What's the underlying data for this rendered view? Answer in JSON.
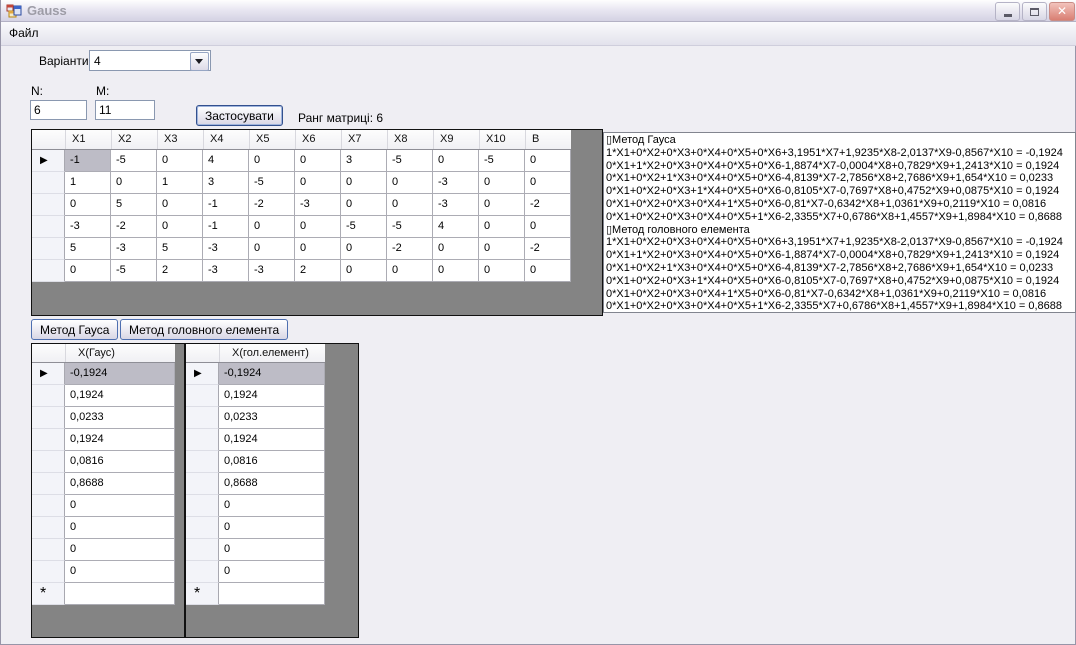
{
  "window": {
    "title": "Gauss"
  },
  "icons": {
    "close": "✕",
    "row_arrow": "▶",
    "new_row": "*"
  },
  "menu": {
    "items": [
      {
        "label": "Файл"
      }
    ]
  },
  "form": {
    "variants_label": "Варіанти:",
    "variants_value": "4",
    "n_label": "N:",
    "n_value": "6",
    "m_label": "M:",
    "m_value": "11",
    "apply_label": "Застосувати",
    "rank_label": "Ранг матриці: 6"
  },
  "matrix_grid": {
    "columns": [
      "X1",
      "X2",
      "X3",
      "X4",
      "X5",
      "X6",
      "X7",
      "X8",
      "X9",
      "X10",
      "B"
    ],
    "rows": [
      [
        -1,
        -5,
        0,
        4,
        0,
        0,
        3,
        -5,
        0,
        -5,
        0
      ],
      [
        1,
        0,
        1,
        3,
        -5,
        0,
        0,
        0,
        -3,
        0,
        0
      ],
      [
        0,
        5,
        0,
        -1,
        -2,
        -3,
        0,
        0,
        -3,
        0,
        -2
      ],
      [
        -3,
        -2,
        0,
        -1,
        0,
        0,
        -5,
        -5,
        4,
        0,
        0
      ],
      [
        5,
        -3,
        5,
        -3,
        0,
        0,
        0,
        -2,
        0,
        0,
        -2
      ],
      [
        0,
        -5,
        2,
        -3,
        -3,
        2,
        0,
        0,
        0,
        0,
        0
      ]
    ],
    "selected": {
      "row": 0,
      "col": 0
    }
  },
  "output_panel": {
    "lines": [
      "▯Метод Гауса",
      "1*X1+0*X2+0*X3+0*X4+0*X5+0*X6+3,1951*X7+1,9235*X8-2,0137*X9-0,8567*X10 = -0,1924",
      "0*X1+1*X2+0*X3+0*X4+0*X5+0*X6-1,8874*X7-0,0004*X8+0,7829*X9+1,2413*X10 = 0,1924",
      "0*X1+0*X2+1*X3+0*X4+0*X5+0*X6-4,8139*X7-2,7856*X8+2,7686*X9+1,654*X10 = 0,0233",
      "0*X1+0*X2+0*X3+1*X4+0*X5+0*X6-0,8105*X7-0,7697*X8+0,4752*X9+0,0875*X10 = 0,1924",
      "0*X1+0*X2+0*X3+0*X4+1*X5+0*X6-0,81*X7-0,6342*X8+1,0361*X9+0,2119*X10 = 0,0816",
      "0*X1+0*X2+0*X3+0*X4+0*X5+1*X6-2,3355*X7+0,6786*X8+1,4557*X9+1,8984*X10 = 0,8688",
      "▯Метод головного елемента",
      "1*X1+0*X2+0*X3+0*X4+0*X5+0*X6+3,1951*X7+1,9235*X8-2,0137*X9-0,8567*X10 = -0,1924",
      "0*X1+1*X2+0*X3+0*X4+0*X5+0*X6-1,8874*X7-0,0004*X8+0,7829*X9+1,2413*X10 = 0,1924",
      "0*X1+0*X2+1*X3+0*X4+0*X5+0*X6-4,8139*X7-2,7856*X8+2,7686*X9+1,654*X10 = 0,0233",
      "0*X1+0*X2+0*X3+1*X4+0*X5+0*X6-0,8105*X7-0,7697*X8+0,4752*X9+0,0875*X10 = 0,1924",
      "0*X1+0*X2+0*X3+0*X4+1*X5+0*X6-0,81*X7-0,6342*X8+1,0361*X9+0,2119*X10 = 0,0816",
      "0*X1+0*X2+0*X3+0*X4+0*X5+1*X6-2,3355*X7+0,6786*X8+1,4557*X9+1,8984*X10 = 0,8688"
    ]
  },
  "method_buttons": {
    "gauss_label": "Метод Гауса",
    "main_label": "Метод головного елемента"
  },
  "result_grids": {
    "gauss": {
      "header": "X(Гаус)",
      "values": [
        "-0,1924",
        "0,1924",
        "0,0233",
        "0,1924",
        "0,0816",
        "0,8688",
        "0",
        "0",
        "0",
        "0"
      ],
      "selected_row": 0
    },
    "main": {
      "header": "X(гол.елемент)",
      "values": [
        "-0,1924",
        "0,1924",
        "0,0233",
        "0,1924",
        "0,0816",
        "0,8688",
        "0",
        "0",
        "0",
        "0"
      ],
      "selected_row": 0
    }
  }
}
